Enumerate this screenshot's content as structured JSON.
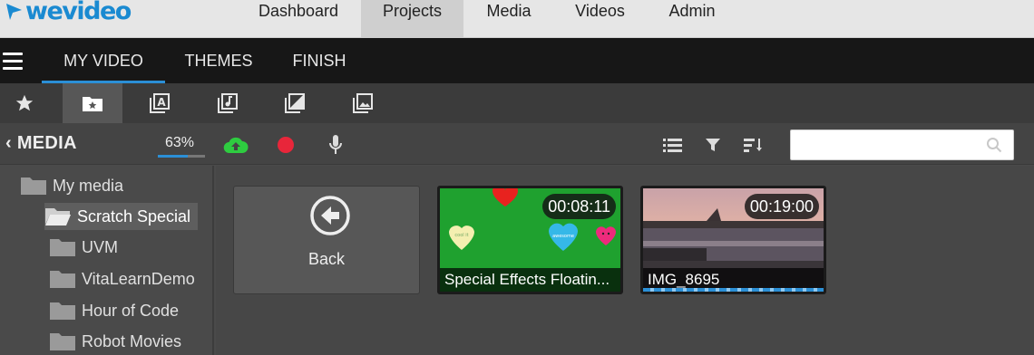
{
  "brand": {
    "logo_text": "wevideo",
    "color": "#1a8ad1"
  },
  "topnav": {
    "items": [
      {
        "label": "Dashboard"
      },
      {
        "label": "Projects",
        "active": true
      },
      {
        "label": "Media"
      },
      {
        "label": "Videos"
      },
      {
        "label": "Admin"
      }
    ]
  },
  "tabs": [
    {
      "label": "MY VIDEO",
      "active": true
    },
    {
      "label": "THEMES"
    },
    {
      "label": "FINISH"
    }
  ],
  "iconbar": {
    "icons": [
      "star-icon",
      "starred-folder-icon",
      "text-icon",
      "audio-icon",
      "transition-icon",
      "image-icon"
    ],
    "active": "starred-folder-icon"
  },
  "media": {
    "title": "MEDIA",
    "storage_percent": "63%",
    "storage_fraction": 0.63,
    "tools": [
      "upload-cloud-icon",
      "record-icon",
      "microphone-icon"
    ],
    "view_tools": [
      "list-view-icon",
      "filter-icon",
      "sort-icon"
    ],
    "search": {
      "value": "",
      "placeholder": ""
    }
  },
  "sidebar": {
    "folders": [
      {
        "label": "My media"
      },
      {
        "label": "Scratch Special",
        "active": true
      },
      {
        "label": "UVM"
      },
      {
        "label": "VitaLearnDemo"
      },
      {
        "label": "Hour of Code"
      },
      {
        "label": "Robot Movies"
      }
    ]
  },
  "content": {
    "back_label": "Back",
    "items": [
      {
        "title": "Special Effects Floatin...",
        "duration": "00:08:11"
      },
      {
        "title": "IMG_8695",
        "duration": "00:19:00"
      }
    ]
  },
  "colors": {
    "accent": "#2b8fd6",
    "upload": "#2ecc40",
    "record": "#e8263a"
  }
}
